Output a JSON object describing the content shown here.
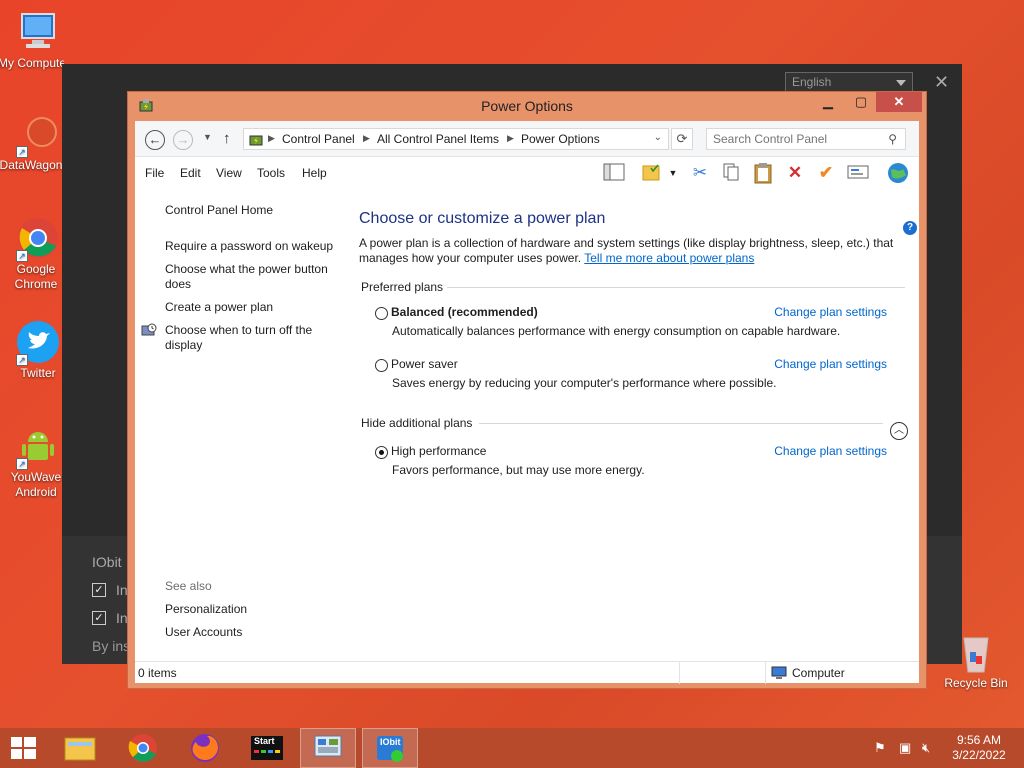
{
  "desktop": {
    "icons": [
      {
        "label": "My Computer"
      },
      {
        "label": "DataWagon"
      },
      {
        "label": "Google Chrome"
      },
      {
        "label": "Twitter"
      },
      {
        "label": "YouWave Android"
      },
      {
        "label": "Recycle Bin"
      }
    ]
  },
  "background_app": {
    "language": "English",
    "section_title": "IObit",
    "check1": "In",
    "check2": "In",
    "footer": "By ins"
  },
  "window": {
    "title": "Power Options",
    "address": {
      "crumbs": [
        "Control Panel",
        "All Control Panel Items",
        "Power Options"
      ]
    },
    "search_placeholder": "Search Control Panel",
    "menu": [
      "File",
      "Edit",
      "View",
      "Tools",
      "Help"
    ],
    "left_pane": {
      "home": "Control Panel Home",
      "links": [
        "Require a password on wakeup",
        "Choose what the power button does",
        "Create a power plan",
        "Choose when to turn off the display"
      ],
      "see_also": "See also",
      "see_also_links": [
        "Personalization",
        "User Accounts"
      ]
    },
    "main": {
      "heading": "Choose or customize a power plan",
      "intro": "A power plan is a collection of hardware and system settings (like display brightness, sleep, etc.) that manages how your computer uses power.",
      "intro_link": "Tell me more about power plans",
      "preferred_label": "Preferred plans",
      "additional_label": "Hide additional plans",
      "change_link": "Change plan settings",
      "plans": [
        {
          "name": "Balanced (recommended)",
          "desc": "Automatically balances performance with energy consumption on capable hardware.",
          "selected": false
        },
        {
          "name": "Power saver",
          "desc": "Saves energy by reducing your computer's performance where possible.",
          "selected": false
        },
        {
          "name": "High performance",
          "desc": "Favors performance, but may use more energy.",
          "selected": true
        }
      ]
    },
    "status": {
      "items": "0 items",
      "location": "Computer"
    }
  },
  "taskbar": {
    "start_label": "Start",
    "iobit_label": "IObit",
    "time": "9:56 AM",
    "date": "3/22/2022"
  },
  "colors": {
    "accent_link": "#0066cc",
    "heading": "#1e3287",
    "window_frame": "#e8926a",
    "close_button": "#c7504b",
    "taskbar": "#b84a2c"
  }
}
